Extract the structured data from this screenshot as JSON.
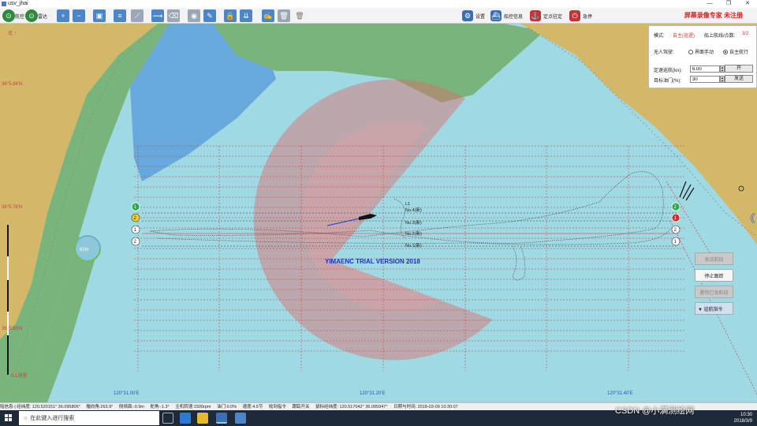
{
  "window": {
    "title": "usv_jhai",
    "min": "—",
    "max": "❐",
    "close": "✕"
  },
  "toolbar": {
    "driving_label": "航控",
    "radar_label": "雷达",
    "settings_label": "设置",
    "ship_info_label": "船控信息",
    "anchor_label": "定点驻定",
    "stop_label": "急停",
    "brand": "屏幕录像专家 未注册"
  },
  "map": {
    "north_label": "北\n↑",
    "lat_labels": [
      "36°5.84'N",
      "36°5.76'N",
      "36°5.68'N"
    ],
    "lon_labels": [
      "120°31.00'E",
      "120°31.20'E",
      "120°31.40'E"
    ],
    "scale_label": "0.1海里",
    "watermark": "YIMAENC TRIAL VERSION 2018",
    "route_labels": [
      "No.4(新)",
      "No.3(新)",
      "No.2(新)",
      "No.1(新)"
    ],
    "top_label": "L1",
    "left_markers": [
      "1",
      "2",
      "1",
      "2"
    ],
    "right_markers": [
      "2",
      "1",
      "2",
      "1"
    ],
    "gauge_value": "62m",
    "colors": {
      "sea": "#9fd9e4",
      "land": "#d3b86a",
      "shoal_green": "#79b47c",
      "deep_blue": "#5ea0dc",
      "radar_red": "#e06a6a",
      "route_red": "#d83030"
    }
  },
  "panel": {
    "mode_label": "模式:",
    "mode_value": "自主(巡逻)",
    "route_label": "船上航线/点数:",
    "route_value": "3/2",
    "unmanned_label": "无人驾驶:",
    "manual_label": "界面手动",
    "auto_label": "自主航行",
    "speed_label": "定速巡航(kn):",
    "speed_value": "6.00",
    "open_button": "开",
    "throttle_label": "目标油门(%):",
    "throttle_value": "30",
    "send_button": "发送"
  },
  "float_buttons": {
    "send_route": "发送航线",
    "stop_follow": "停止跟踪",
    "delete_route": "删除已发航线",
    "cmd_menu": "▼ 巡航指令"
  },
  "status": {
    "ship_pos": "船信息-| 经纬度: 120.520151°  36.095806°",
    "heading": "艏向角:263.9°",
    "roll": "侧倾面:-0.9m",
    "rudder": "舵角:-1.3°",
    "rpm": "主机转速:1500rpm",
    "throttle": "油门:0.0%",
    "speed": "速度:4.5节",
    "recv": "收到指令",
    "follow": "跟踪开关",
    "mouse": "鼠标经纬度: 120.517042°  36.095947°",
    "datetime": "日期与时间: 2018-03-09  10:30:07"
  },
  "taskbar": {
    "search_placeholder": "在此键入进行搜索",
    "time": "10:30",
    "date": "2018/3/9",
    "watermark": "CSDN @小满测绘网"
  }
}
